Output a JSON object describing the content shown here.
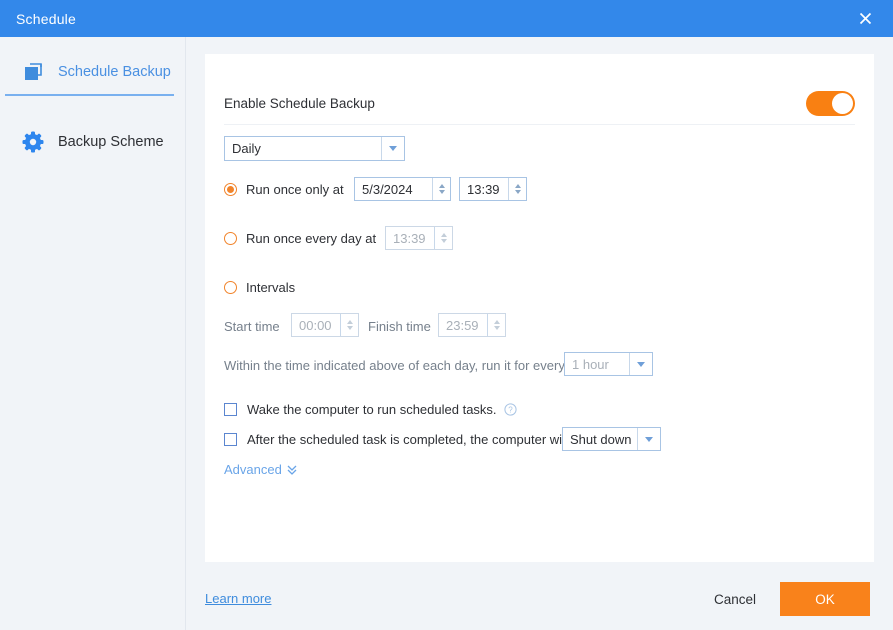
{
  "window": {
    "title": "Schedule",
    "close_icon": "close-icon"
  },
  "sidebar": {
    "items": [
      {
        "label": "Schedule Backup",
        "icon": "copy-stack-icon",
        "active": true
      },
      {
        "label": "Backup Scheme",
        "icon": "gear-icon",
        "active": false
      }
    ]
  },
  "main": {
    "enable": {
      "label": "Enable Schedule Backup",
      "toggle_state": "on",
      "toggle_color": "#f98012"
    },
    "frequency_select": {
      "value": "Daily",
      "arrow_icon": "chevron-down-icon"
    },
    "run_once_only": {
      "label": "Run once only at",
      "selected": true,
      "date_value": "5/3/2024",
      "time_value": "13:39"
    },
    "run_once_every_day": {
      "label": "Run once every day at",
      "selected": false,
      "time_value": "13:39",
      "disabled": true
    },
    "intervals": {
      "label": "Intervals",
      "selected": false,
      "start_time_label": "Start time",
      "start_time_value": "00:00",
      "finish_time_label": "Finish time",
      "finish_time_value": "23:59",
      "every_label": "Within the time indicated above of each day, run it for every",
      "every_value": "1 hour",
      "disabled": true
    },
    "wake_checkbox": {
      "label": "Wake the computer to run scheduled tasks.",
      "checked": false,
      "help_icon": "question-circle-icon"
    },
    "after_task_checkbox": {
      "label": "After the scheduled task is completed, the computer will",
      "checked": false,
      "action_value": "Shut down"
    },
    "advanced": {
      "label": "Advanced",
      "icon": "double-chevron-down-icon"
    }
  },
  "footer": {
    "learn_more": "Learn more",
    "cancel": "Cancel",
    "ok": "OK",
    "ok_color": "#f9821b"
  }
}
